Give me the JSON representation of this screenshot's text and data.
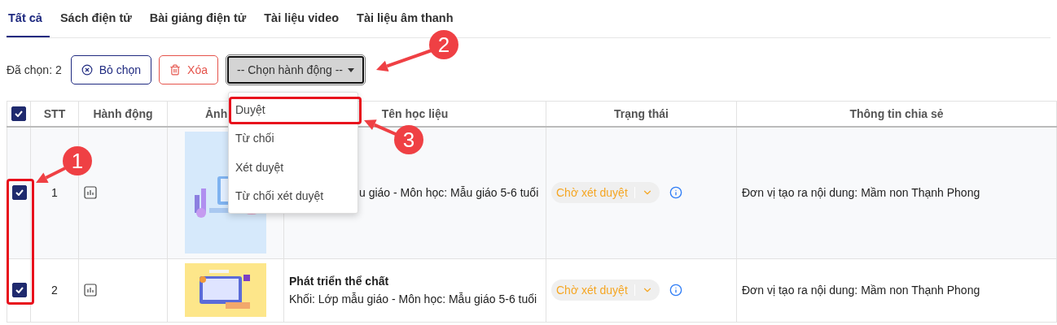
{
  "tabs": [
    {
      "label": "Tất cả",
      "selected": true
    },
    {
      "label": "Sách điện tử",
      "selected": false
    },
    {
      "label": "Bài giảng điện tử",
      "selected": false
    },
    {
      "label": "Tài liệu video",
      "selected": false
    },
    {
      "label": "Tài liệu âm thanh",
      "selected": false
    }
  ],
  "toolbar": {
    "selected_count": "Đã chọn: 2",
    "deselect_button": "Bỏ chọn",
    "delete_button": "Xóa",
    "action_select": "-- Chọn hành động --"
  },
  "action_menu": {
    "items": [
      "Duyệt",
      "Từ chối",
      "Xét duyệt",
      "Từ chối xét duyệt"
    ]
  },
  "table": {
    "select_all_checked": true,
    "columns": [
      "STT",
      "Hành động",
      "Ảnh",
      "Tên học liệu",
      "Trạng thái",
      "Thông tin chia sẻ"
    ],
    "rows": [
      {
        "checked": true,
        "index": "1",
        "partly_hidden": true,
        "description": "u giáo - Môn học: Mẫu giáo 5-6 tuổi",
        "status": "Chờ xét duyệt",
        "share_info": "Đơn vị tạo ra nội dung: Mầm non Thạnh Phong"
      },
      {
        "checked": true,
        "index": "2",
        "partly_hidden": false,
        "title": "Phát triển thể chất",
        "description": "Khối: Lớp mẫu giáo - Môn học: Mẫu giáo 5-6 tuổi",
        "status": "Chờ xét duyệt",
        "share_info": "Đơn vị tạo ra nội dung: Mầm non Thạnh Phong"
      }
    ]
  },
  "annotations": [
    {
      "label": "1"
    },
    {
      "label": "2"
    },
    {
      "label": "3"
    }
  ]
}
